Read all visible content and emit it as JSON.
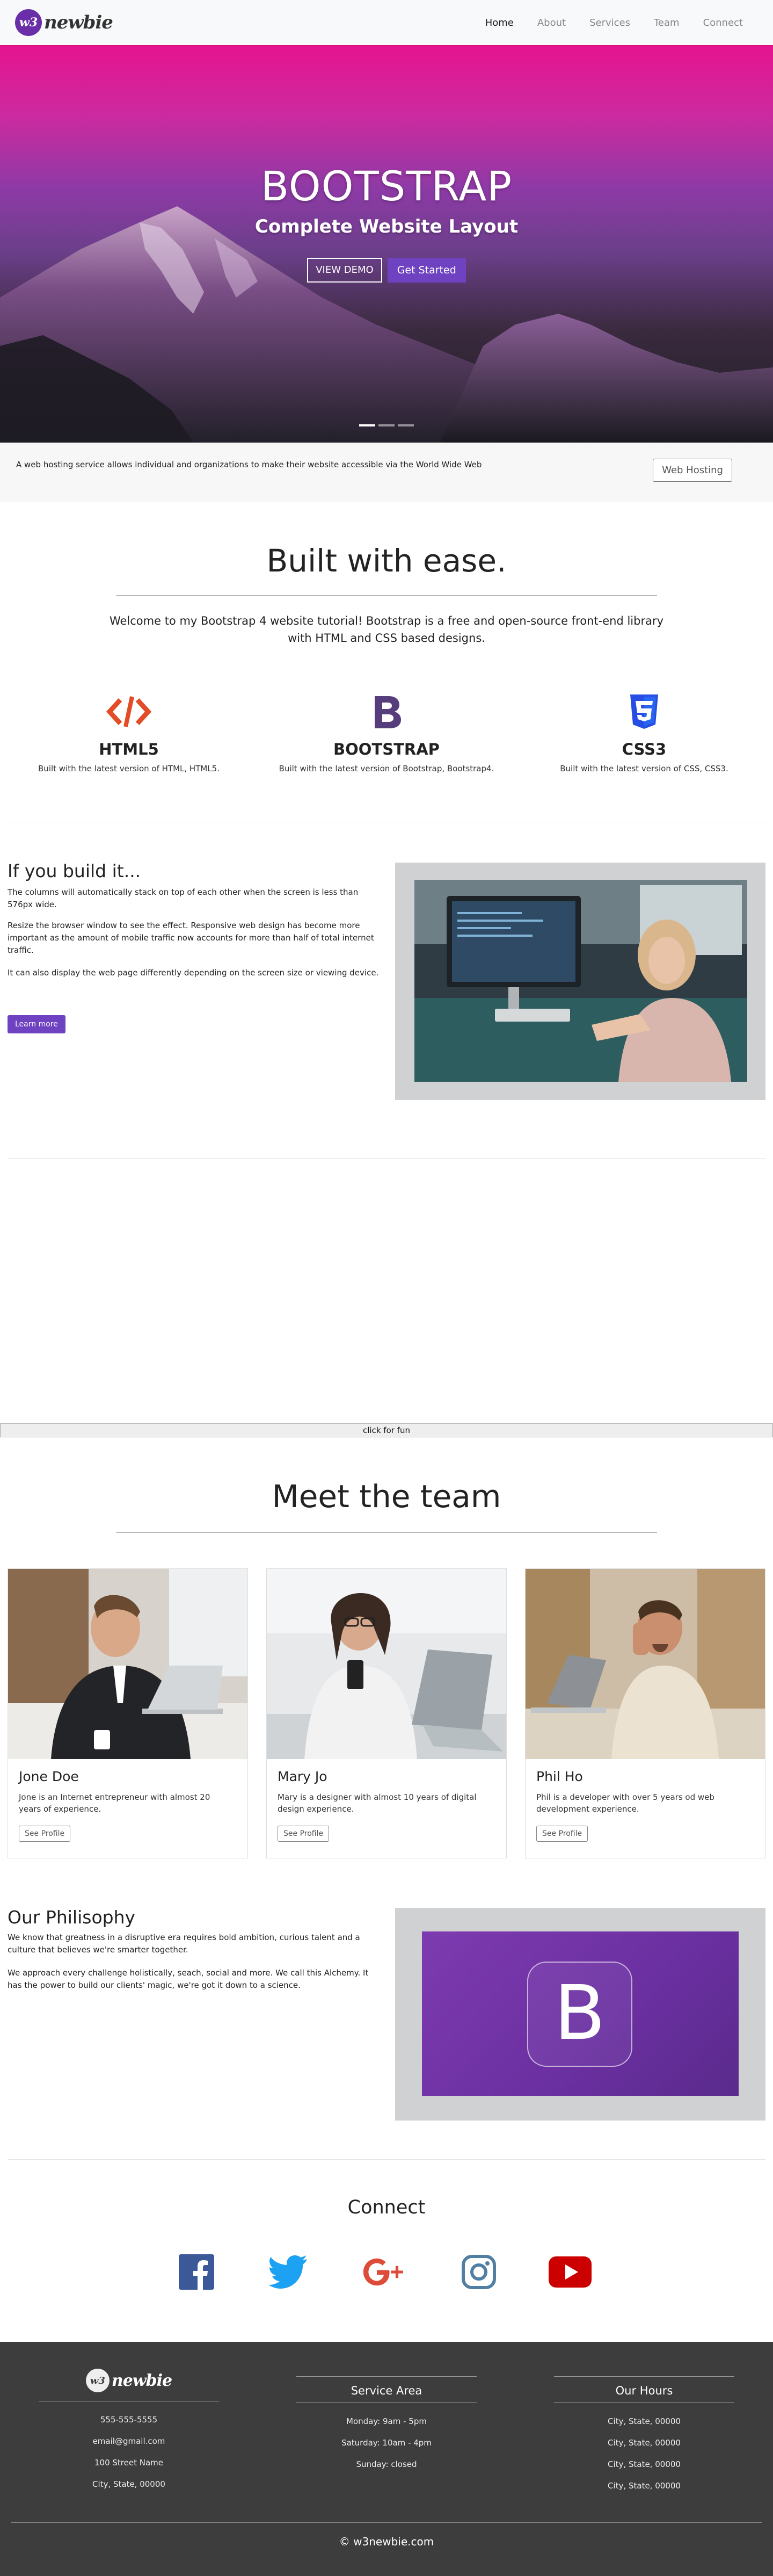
{
  "nav": {
    "logo_badge": "w3",
    "logo_text": "newbie",
    "links": [
      "Home",
      "About",
      "Services",
      "Team",
      "Connect"
    ]
  },
  "hero": {
    "title": "BOOTSTRAP",
    "subtitle": "Complete Website Layout",
    "btn_demo": "VIEW DEMO",
    "btn_start": "Get Started"
  },
  "jumbo": {
    "text": "A web hosting service allows individual and organizations to make their website accessible via the World Wide Web",
    "button": "Web Hosting"
  },
  "ease": {
    "title": "Built with ease.",
    "welcome": "Welcome to my Bootstrap 4 website tutorial! Bootstrap is a free and open-source front-end library with HTML and CSS based designs.",
    "features": [
      {
        "name": "HTML5",
        "desc": "Built with the latest version of HTML, HTML5.",
        "icon": "code-icon",
        "color": "#e34c26"
      },
      {
        "name": "BOOTSTRAP",
        "desc": "Built with the latest version of Bootstrap, Bootstrap4.",
        "icon": "bootstrap-icon",
        "color": "#563d7c"
      },
      {
        "name": "CSS3",
        "desc": "Built with the latest version of CSS, CSS3.",
        "icon": "css3-icon",
        "color": "#264de4"
      }
    ]
  },
  "build": {
    "title": "If you build it...",
    "p1": "The columns will automatically stack on top of each other when the screen is less than 576px wide.",
    "p2": "Resize the browser window to see the effect. Responsive web design has become more important as the amount of mobile traffic now accounts for more than half of total internet traffic.",
    "p3": "It can also display the web page differently depending on the screen size or viewing device.",
    "button": "Learn more"
  },
  "fun": {
    "button": "click for fun"
  },
  "team": {
    "title": "Meet the team",
    "members": [
      {
        "name": "Jone Doe",
        "bio": "Jone is an Internet entrepreneur with almost 20 years of experience.",
        "button": "See Profile"
      },
      {
        "name": "Mary Jo",
        "bio": "Mary is a designer with almost 10 years of digital design experience.",
        "button": "See Profile"
      },
      {
        "name": "Phil Ho",
        "bio": "Phil is a developer with over 5 years od web development experience.",
        "button": "See Profile"
      }
    ]
  },
  "philosophy": {
    "title": "Our Philisophy",
    "p1": "We know that greatness in a disruptive era requires bold ambition, curious talent and a culture that believes we're smarter together.",
    "p2": "We approach every challenge holistically, seach, social and more. We call this Alchemy. It has the power to build our clients' magic, we're got it down to a science.",
    "logo_letter": "B"
  },
  "connect": {
    "title": "Connect",
    "icons": [
      {
        "name": "facebook-icon",
        "color": "#3b5998"
      },
      {
        "name": "twitter-icon",
        "color": "#1da1f2"
      },
      {
        "name": "google-plus-icon",
        "color": "#dd4b39"
      },
      {
        "name": "instagram-icon",
        "color": "#517fa4"
      },
      {
        "name": "youtube-icon",
        "color": "#cc0000"
      }
    ]
  },
  "footer": {
    "logo_badge": "w3",
    "logo_text": "newbie",
    "contact": [
      "555-555-5555",
      "email@gmail.com",
      "100 Street Name",
      "City, State, 00000"
    ],
    "service_title": "Service Area",
    "service": [
      "Monday: 9am - 5pm",
      "Saturday: 10am - 4pm",
      "Sunday: closed"
    ],
    "hours_title": "Our Hours",
    "hours": [
      "City, State, 00000",
      "City, State, 00000",
      "City, State, 00000",
      "City, State, 00000"
    ],
    "copyright": "© w3newbie.com"
  },
  "colors": {
    "accent_purple": "#6f42c1",
    "footer_bg": "#3d3d3d"
  }
}
